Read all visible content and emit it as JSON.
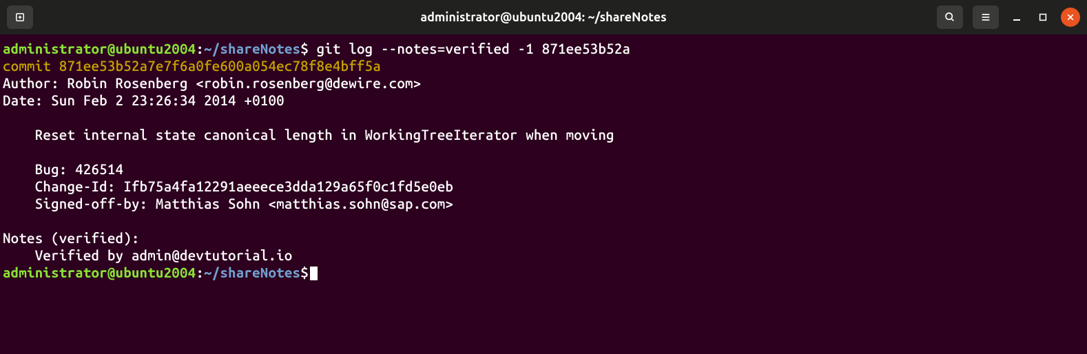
{
  "titlebar": {
    "title": "administrator@ubuntu2004: ~/shareNotes"
  },
  "terminal": {
    "prompt1": {
      "user": "administrator@ubuntu2004",
      "colon": ":",
      "path": "~/shareNotes",
      "dollar": "$",
      "command": "git log --notes=verified -1 871ee53b52a"
    },
    "commitLine": "commit 871ee53b52a7e7f6a0fe600a054ec78f8e4bff5a",
    "authorLine": "Author: Robin Rosenberg <robin.rosenberg@dewire.com>",
    "dateLine": "Date:   Sun Feb 2 23:26:34 2014 +0100",
    "msgLine": "    Reset internal state canonical length in WorkingTreeIterator when moving",
    "bugLine": "    Bug: 426514",
    "changeIdLine": "    Change-Id: Ifb75a4fa12291aeeece3dda129a65f0c1fd5e0eb",
    "signedOffLine": "    Signed-off-by: Matthias Sohn <matthias.sohn@sap.com>",
    "notesHeader": "Notes (verified):",
    "notesBody": "    Verified by admin@devtutorial.io",
    "prompt2": {
      "user": "administrator@ubuntu2004",
      "colon": ":",
      "path": "~/shareNotes",
      "dollar": "$"
    }
  }
}
